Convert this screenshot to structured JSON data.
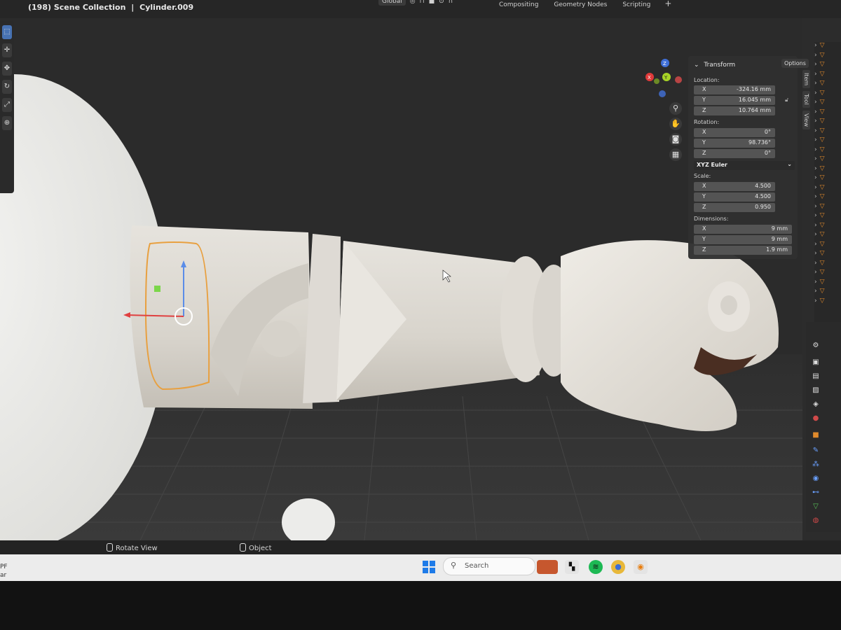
{
  "header": {
    "breadcrumb_left": "(198) Scene Collection",
    "separator": "|",
    "active_object": "Cylinder.009",
    "orientation": "Global",
    "workspaces": [
      "Compositing",
      "Geometry Nodes",
      "Scripting"
    ],
    "add_workspace": "+"
  },
  "toolbar": {
    "tools": [
      "select-tool",
      "cursor-tool",
      "move-tool",
      "rotate-tool",
      "scale-tool",
      "transform-tool"
    ]
  },
  "navigation": {
    "gizmo_axes": [
      "X",
      "Y",
      "Z"
    ],
    "buttons": [
      "zoom",
      "pan",
      "camera",
      "grid"
    ]
  },
  "npanel": {
    "section": "Transform",
    "options_label": "Options",
    "location_label": "Location:",
    "location": [
      {
        "axis": "X",
        "value": "-324.16 mm"
      },
      {
        "axis": "Y",
        "value": "16.045 mm"
      },
      {
        "axis": "Z",
        "value": "10.764 mm"
      }
    ],
    "rotation_label": "Rotation:",
    "rotation": [
      {
        "axis": "X",
        "value": "0°"
      },
      {
        "axis": "Y",
        "value": "98.736°"
      },
      {
        "axis": "Z",
        "value": "0°"
      }
    ],
    "rotation_mode": "XYZ Euler",
    "scale_label": "Scale:",
    "scale": [
      {
        "axis": "X",
        "value": "4.500"
      },
      {
        "axis": "Y",
        "value": "4.500"
      },
      {
        "axis": "Z",
        "value": "0.950"
      }
    ],
    "dimensions_label": "Dimensions:",
    "dimensions": [
      {
        "axis": "X",
        "value": "9 mm"
      },
      {
        "axis": "Y",
        "value": "9 mm"
      },
      {
        "axis": "Z",
        "value": "1.9 mm"
      }
    ],
    "tabs": [
      "Item",
      "Tool",
      "View"
    ]
  },
  "status_bar": {
    "rotate_view": "Rotate View",
    "object": "Object"
  },
  "taskbar": {
    "search_placeholder": "Search",
    "left_line1": "PF",
    "left_line2": "ar",
    "apps": [
      "widgets-icon",
      "task-view-icon",
      "spotify-icon",
      "chrome-icon",
      "blender-icon"
    ]
  },
  "colors": {
    "accent_blue": "#4772b3",
    "selection_orange": "#e8a040",
    "viewport_bg": "#2c2c2c"
  }
}
